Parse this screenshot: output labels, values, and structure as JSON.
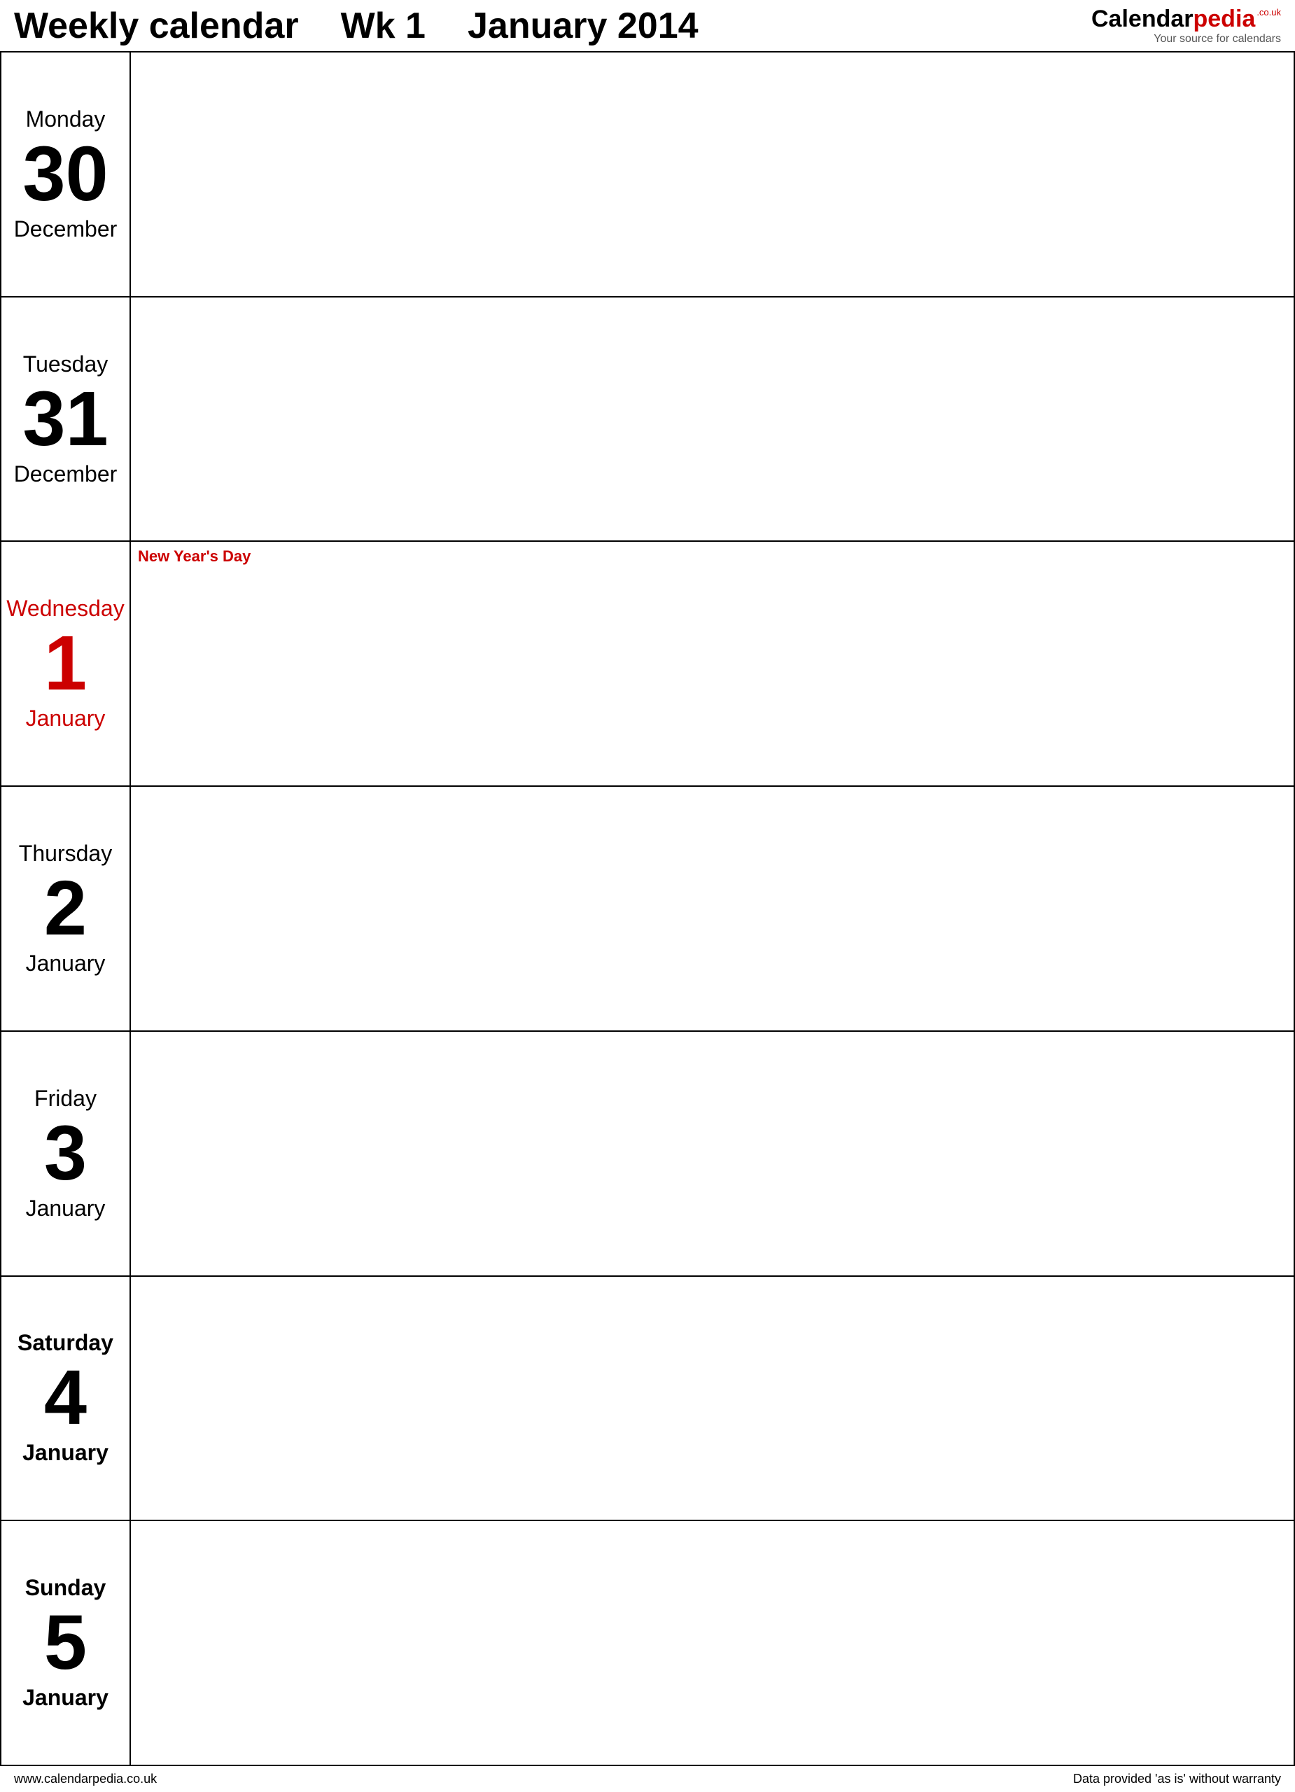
{
  "header": {
    "title": "Weekly calendar",
    "week": "Wk 1",
    "month_year": "January 2014"
  },
  "logo": {
    "part1": "Calendar",
    "part2": "pedia",
    "couk": ".co.uk",
    "tagline": "Your source for calendars"
  },
  "days": [
    {
      "name": "Monday",
      "number": "30",
      "month": "December",
      "holiday": false,
      "weekend": false,
      "holiday_label": ""
    },
    {
      "name": "Tuesday",
      "number": "31",
      "month": "December",
      "holiday": false,
      "weekend": false,
      "holiday_label": ""
    },
    {
      "name": "Wednesday",
      "number": "1",
      "month": "January",
      "holiday": true,
      "weekend": false,
      "holiday_label": "New Year's Day"
    },
    {
      "name": "Thursday",
      "number": "2",
      "month": "January",
      "holiday": false,
      "weekend": false,
      "holiday_label": ""
    },
    {
      "name": "Friday",
      "number": "3",
      "month": "January",
      "holiday": false,
      "weekend": false,
      "holiday_label": ""
    },
    {
      "name": "Saturday",
      "number": "4",
      "month": "January",
      "holiday": false,
      "weekend": true,
      "holiday_label": ""
    },
    {
      "name": "Sunday",
      "number": "5",
      "month": "January",
      "holiday": false,
      "weekend": true,
      "holiday_label": ""
    }
  ],
  "footer": {
    "url": "www.calendarpedia.co.uk",
    "disclaimer": "Data provided 'as is' without warranty"
  }
}
